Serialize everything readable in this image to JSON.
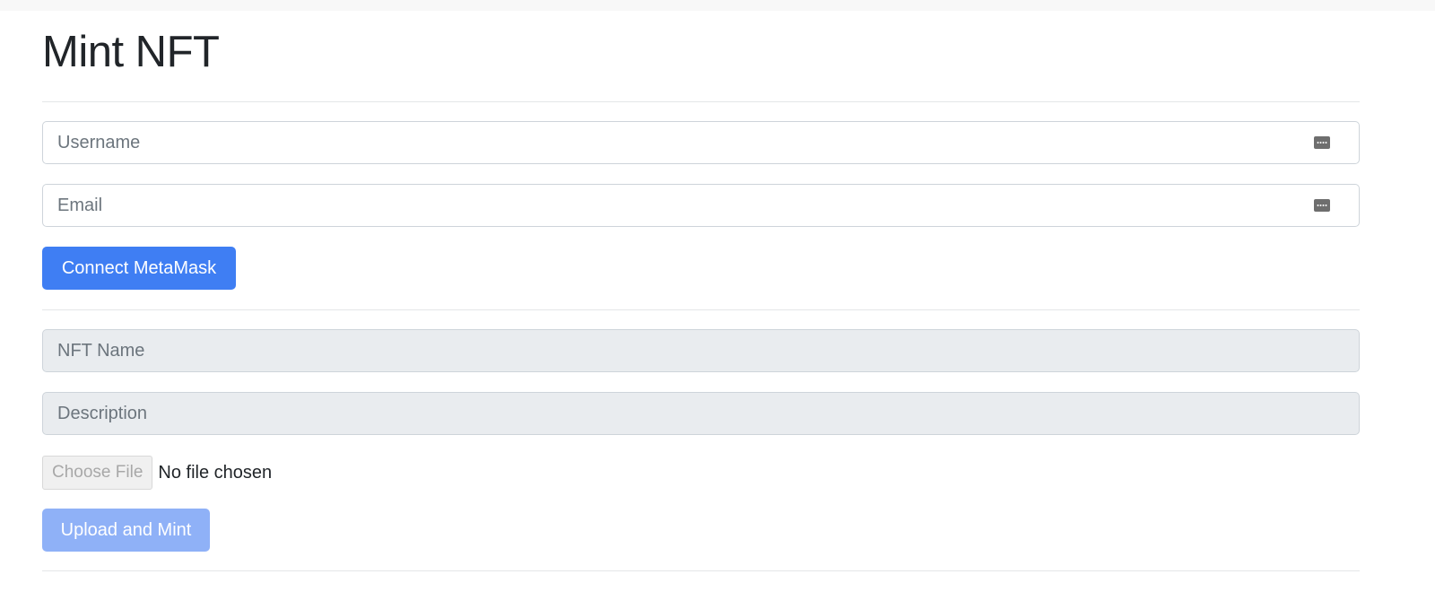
{
  "page": {
    "title": "Mint NFT"
  },
  "account_form": {
    "username_placeholder": "Username",
    "email_placeholder": "Email",
    "autofill_icon": "password-manager-icon",
    "connect_label": "Connect MetaMask"
  },
  "mint_form": {
    "nft_name_placeholder": "NFT Name",
    "description_placeholder": "Description",
    "file_button_label": "Choose File",
    "file_status": "No file chosen",
    "submit_label": "Upload and Mint"
  },
  "colors": {
    "primary": "#3f7ef3",
    "primary_disabled": "#8fb1f7",
    "disabled_field": "#e9ecef"
  }
}
